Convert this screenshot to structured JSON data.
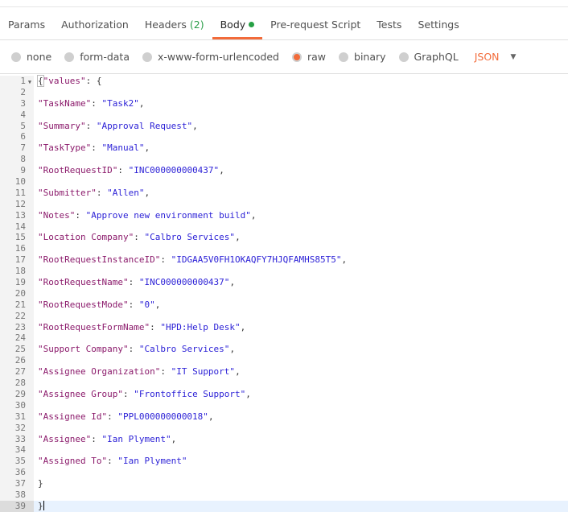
{
  "tabs": [
    {
      "label": "Params"
    },
    {
      "label": "Authorization"
    },
    {
      "label": "Headers",
      "count": "(2)"
    },
    {
      "label": "Body",
      "active": true
    },
    {
      "label": "Pre-request Script"
    },
    {
      "label": "Tests"
    },
    {
      "label": "Settings"
    }
  ],
  "body_options": [
    {
      "label": "none",
      "selected": false
    },
    {
      "label": "form-data",
      "selected": false
    },
    {
      "label": "x-www-form-urlencoded",
      "selected": false
    },
    {
      "label": "raw",
      "selected": true
    },
    {
      "label": "binary",
      "selected": false
    },
    {
      "label": "GraphQL",
      "selected": false
    }
  ],
  "language": "JSON",
  "code": {
    "open_key": "\"values\"",
    "pairs": [
      {
        "k": "\"TaskName\"",
        "v": "\"Task2\"",
        "t": ","
      },
      {
        "k": "\"Summary\"",
        "v": "\"Approval Request\"",
        "t": ","
      },
      {
        "k": "\"TaskType\"",
        "v": "\"Manual\"",
        "t": ","
      },
      {
        "k": "\"RootRequestID\"",
        "v": "\"INC000000000437\"",
        "t": ","
      },
      {
        "k": "\"Submitter\"",
        "v": "\"Allen\"",
        "t": ","
      },
      {
        "k": "\"Notes\"",
        "v": "\"Approve new environment build\"",
        "t": ","
      },
      {
        "k": "\"Location Company\"",
        "v": "\"Calbro Services\"",
        "t": ","
      },
      {
        "k": "\"RootRequestInstanceID\"",
        "v": "\"IDGAA5V0FH1OKAQFY7HJQFAMHS85T5\"",
        "t": ","
      },
      {
        "k": "\"RootRequestName\"",
        "v": "\"INC000000000437\"",
        "t": ","
      },
      {
        "k": "\"RootRequestMode\"",
        "v": "\"0\"",
        "t": ","
      },
      {
        "k": "\"RootRequestFormName\"",
        "v": "\"HPD:Help Desk\"",
        "t": ","
      },
      {
        "k": "\"Support Company\"",
        "v": "\"Calbro Services\"",
        "t": ","
      },
      {
        "k": "\"Assignee Organization\"",
        "v": "\"IT Support\"",
        "t": ","
      },
      {
        "k": "\"Assignee Group\"",
        "v": "\"Frontoffice Support\"",
        "t": ","
      },
      {
        "k": "\"Assignee Id\"",
        "v": "\"PPL000000000018\"",
        "t": ","
      },
      {
        "k": "\"Assignee\"",
        "v": "\"Ian Plyment\"",
        "t": ","
      },
      {
        "k": "\"Assigned To\"",
        "v": "\"Ian Plyment\"",
        "t": ""
      }
    ]
  },
  "colors": {
    "accent": "#f26b3a",
    "success": "#26a045",
    "key": "#8b1a6b",
    "string": "#2a1fd6"
  }
}
